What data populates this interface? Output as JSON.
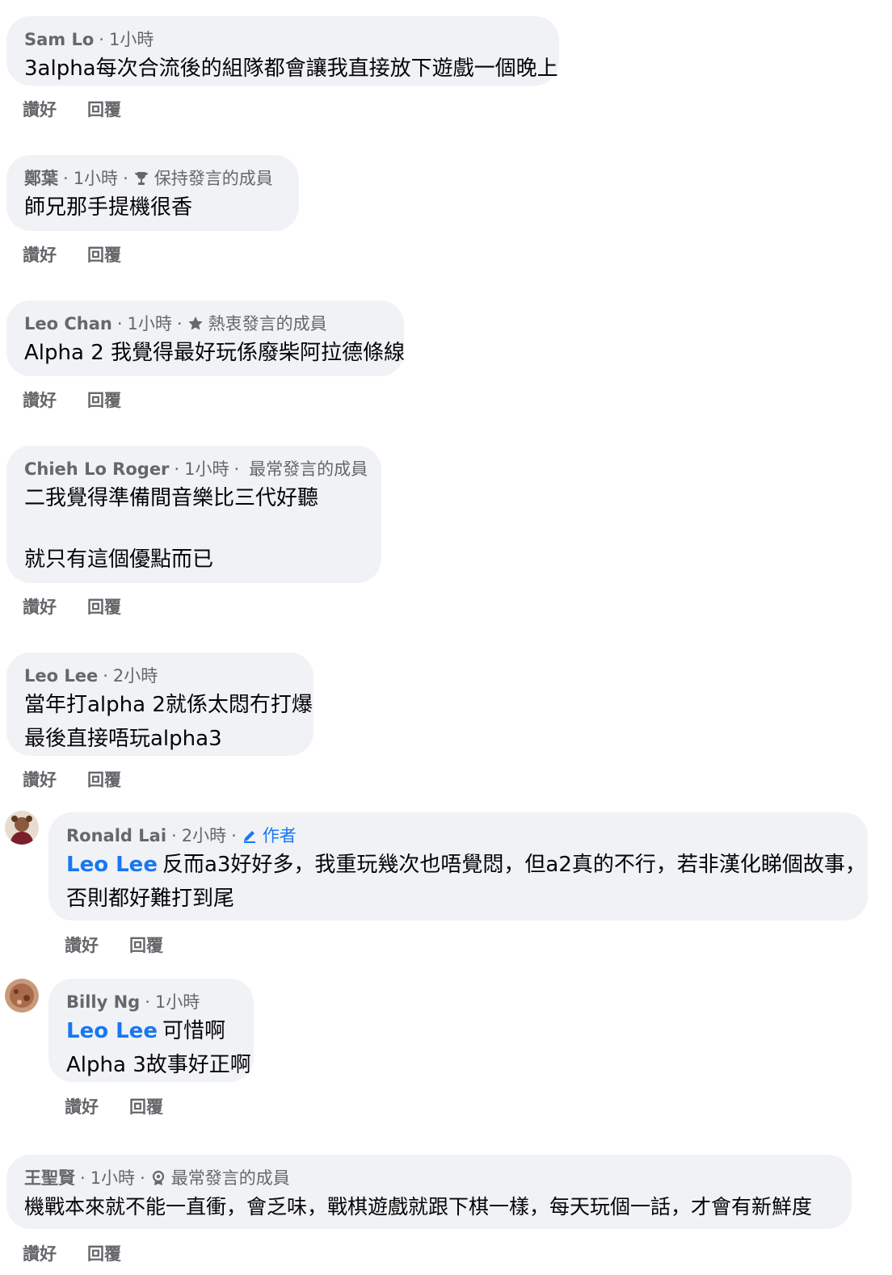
{
  "actions": {
    "like": "讚好",
    "reply": "回覆"
  },
  "comments": [
    {
      "name": "Sam Lo",
      "time": "1小時",
      "badge": "",
      "lines": [
        "3alpha每次合流後的組隊都會讓我直接放下遊戲一個晚上"
      ]
    },
    {
      "name": "鄭葉",
      "time": "1小時",
      "badge": "保持發言的成員",
      "lines": [
        "師兄那手提機很香"
      ]
    },
    {
      "name": "Leo Chan",
      "time": "1小時",
      "badge": "熱衷發言的成員",
      "lines": [
        "Alpha 2 我覺得最好玩係廢柴阿拉德條線"
      ]
    },
    {
      "name": "Chieh Lo Roger",
      "time": "1小時",
      "badge": "最常發言的成員",
      "lines": [
        "二我覺得準備間音樂比三代好聽",
        "",
        "就只有這個優點而已"
      ]
    },
    {
      "name": "Leo Lee",
      "time": "2小時",
      "badge": "",
      "lines": [
        "當年打alpha 2就係太悶冇打爆",
        "最後直接唔玩alpha3"
      ]
    },
    {
      "name": "Ronald Lai",
      "time": "2小時",
      "badge": "作者",
      "tag": "Leo Lee",
      "lines": [
        "反而a3好好多，我重玩幾次也唔覺悶，但a2真的不行，若非漢化睇個故事，",
        "否則都好難打到尾"
      ]
    },
    {
      "name": "Billy Ng",
      "time": "1小時",
      "badge": "",
      "tag": "Leo Lee",
      "lines": [
        "可惜啊",
        "Alpha 3故事好正啊"
      ]
    },
    {
      "name": "王聖賢",
      "time": "1小時",
      "badge": "最常發言的成員",
      "lines": [
        "機戰本來就不能一直衝，會乏味，戰棋遊戲就跟下棋一樣，每天玩個一話，才會有新鮮度"
      ]
    }
  ],
  "colors": {
    "bubble": "#f0f2f5",
    "meta": "#65676b",
    "link": "#1877f2"
  }
}
